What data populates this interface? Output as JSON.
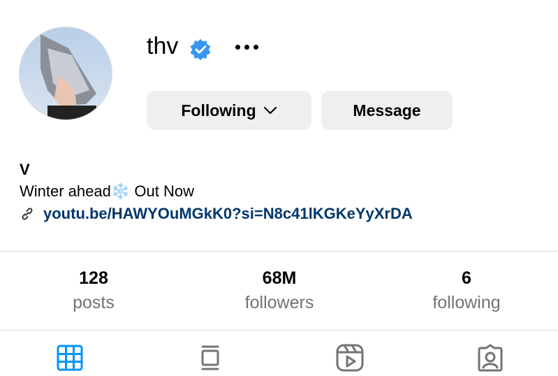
{
  "profile": {
    "username": "thv",
    "display_name": "V",
    "bio_text": "Winter ahead",
    "bio_emoji": "❄️",
    "bio_suffix": " Out Now",
    "link": "youtu.be/HAWYOuMGkK0?si=N8c41lKGKeYyXrDA"
  },
  "actions": {
    "following_label": "Following",
    "message_label": "Message"
  },
  "stats": [
    {
      "value": "128",
      "label": "posts"
    },
    {
      "value": "68M",
      "label": "followers"
    },
    {
      "value": "6",
      "label": "following"
    }
  ],
  "tabs": [
    {
      "icon": "grid-icon",
      "active": true
    },
    {
      "icon": "feed-icon",
      "active": false
    },
    {
      "icon": "reels-icon",
      "active": false
    },
    {
      "icon": "tagged-icon",
      "active": false
    }
  ],
  "colors": {
    "verified": "#3797f0",
    "link": "#00376b",
    "active_tab": "#0095f6",
    "muted": "#737373",
    "button_bg": "#efefef"
  }
}
